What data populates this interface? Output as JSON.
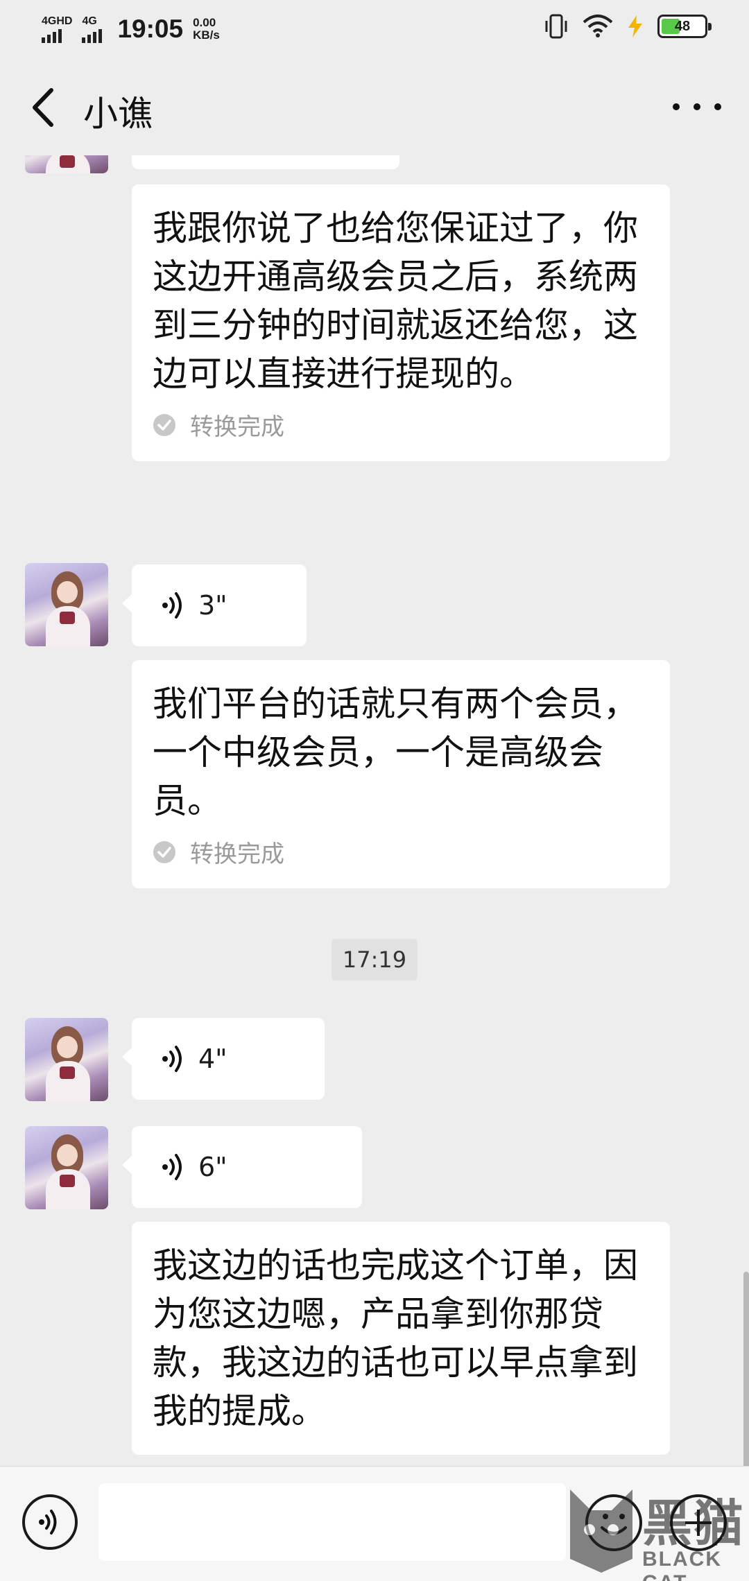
{
  "status_bar": {
    "sim1_label": "4GHD",
    "sim2_label": "4G",
    "time": "19:05",
    "net_speed_value": "0.00",
    "net_speed_unit": "KB/s",
    "battery_level": "48",
    "icons": [
      "vibrate-icon",
      "wifi-icon",
      "charging-icon",
      "battery-icon"
    ]
  },
  "header": {
    "title": "小谯",
    "back_icon": "chevron-left-icon",
    "more_icon": "more-dots-icon"
  },
  "messages": [
    {
      "type": "text",
      "text": "我跟你说了也给您保证过了，你这边开通高级会员之后，系统两到三分钟的时间就返还给您，这边可以直接进行提现的。",
      "status": "转换完成"
    },
    {
      "type": "voice",
      "duration": "3\""
    },
    {
      "type": "text",
      "text": "我们平台的话就只有两个会员，一个中级会员，一个是高级会员。",
      "status": "转换完成"
    },
    {
      "type": "timestamp",
      "text": "17:19"
    },
    {
      "type": "voice",
      "duration": "4\""
    },
    {
      "type": "voice",
      "duration": "6\""
    },
    {
      "type": "text",
      "text": "我这边的话也完成这个订单，因为您这边嗯，产品拿到你那贷款，我这边的话也可以早点拿到我的提成。"
    }
  ],
  "input_bar": {
    "voice_toggle_icon": "voice-input-icon",
    "text_value": "",
    "emoji_icon": "emoji-icon",
    "plus_icon": "plus-icon"
  },
  "watermark": {
    "text_cn": "黑猫",
    "text_en": "BLACK CAT"
  },
  "colors": {
    "background": "#ededed",
    "bubble": "#ffffff",
    "battery_fill": "#59c94a"
  }
}
